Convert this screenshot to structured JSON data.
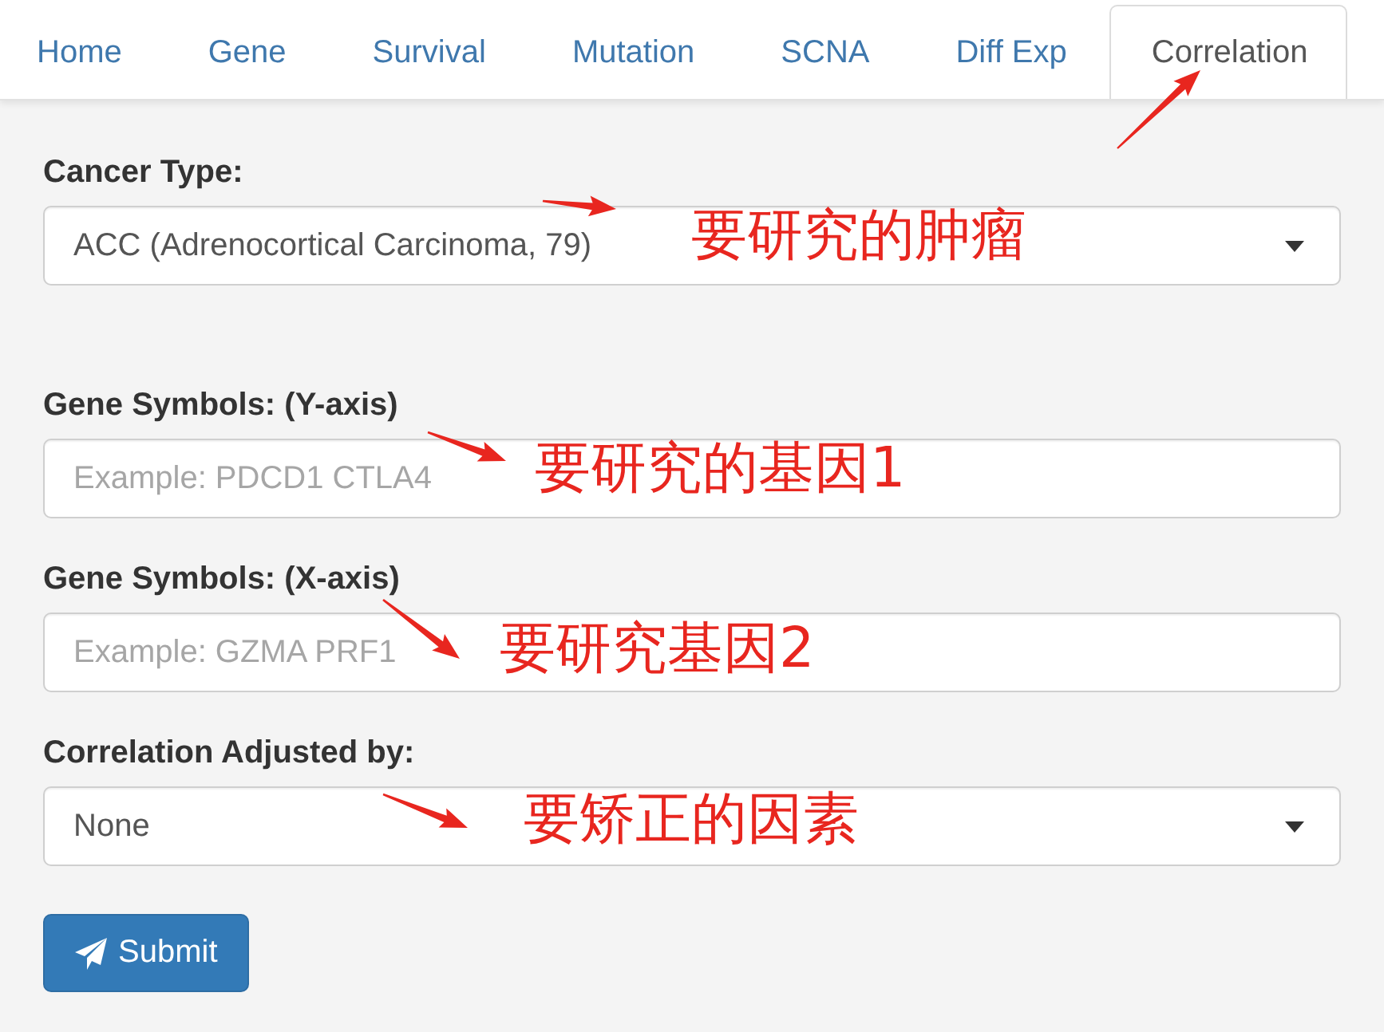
{
  "tabs": [
    {
      "label": "Home",
      "selected": false
    },
    {
      "label": "Gene",
      "selected": false
    },
    {
      "label": "Survival",
      "selected": false
    },
    {
      "label": "Mutation",
      "selected": false
    },
    {
      "label": "SCNA",
      "selected": false
    },
    {
      "label": "Diff Exp",
      "selected": false
    },
    {
      "label": "Correlation",
      "selected": true
    }
  ],
  "form": {
    "fields": [
      {
        "kind": "select",
        "label": "Cancer Type:",
        "value": "ACC (Adrenocortical Carcinoma, 79)"
      },
      {
        "kind": "input",
        "label": "Gene Symbols: (Y-axis)",
        "placeholder": "Example: PDCD1 CTLA4"
      },
      {
        "kind": "input",
        "label": "Gene Symbols: (X-axis)",
        "placeholder": "Example: GZMA PRF1"
      },
      {
        "kind": "select",
        "label": "Correlation Adjusted by:",
        "value": "None"
      }
    ],
    "submit": "Submit"
  },
  "annotations": [
    {
      "text": "要研究的肿瘤"
    },
    {
      "text": "要研究的基因1"
    },
    {
      "text": "要研究基因2"
    },
    {
      "text": "要矫正的因素"
    }
  ]
}
